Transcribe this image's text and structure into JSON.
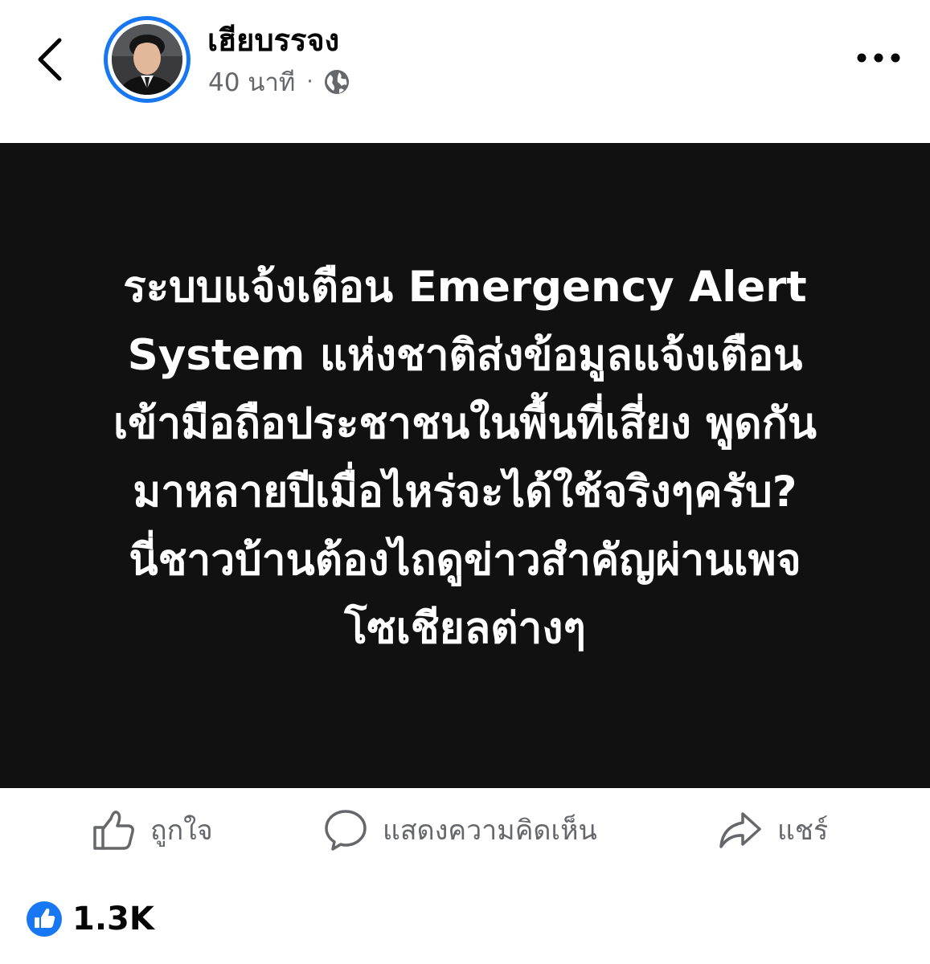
{
  "header": {
    "author_name": "เฮียบรรจง",
    "timestamp": "40 นาที",
    "separator": "·",
    "audience_icon": "globe-icon",
    "back_icon": "chevron-left-icon",
    "more_icon": "more-horizontal-icon",
    "avatar_ring_color": "#1877f2"
  },
  "post": {
    "background_color": "#111111",
    "text_color": "#ffffff",
    "lines": [
      "ระบบแจ้งเตือน Emergency Alert",
      "System แห่งชาติส่งข้อมูลแจ้งเตือน",
      "เข้ามือถือประชาชนในพื้นที่เสี่ยง พูดกัน",
      "มาหลายปีเมื่อไหร่จะได้ใช้จริงๆครับ?",
      "นี่ชาวบ้านต้องไถดูข่าวสำคัญผ่านเพจ",
      "โซเชียลต่างๆ"
    ]
  },
  "actions": {
    "like_label": "ถูกใจ",
    "comment_label": "แสดงความคิดเห็น",
    "share_label": "แชร์",
    "icon_color": "#65676b"
  },
  "reactions": {
    "count": "1.3K",
    "icon": "like-reaction-icon",
    "icon_color": "#1877f2"
  }
}
